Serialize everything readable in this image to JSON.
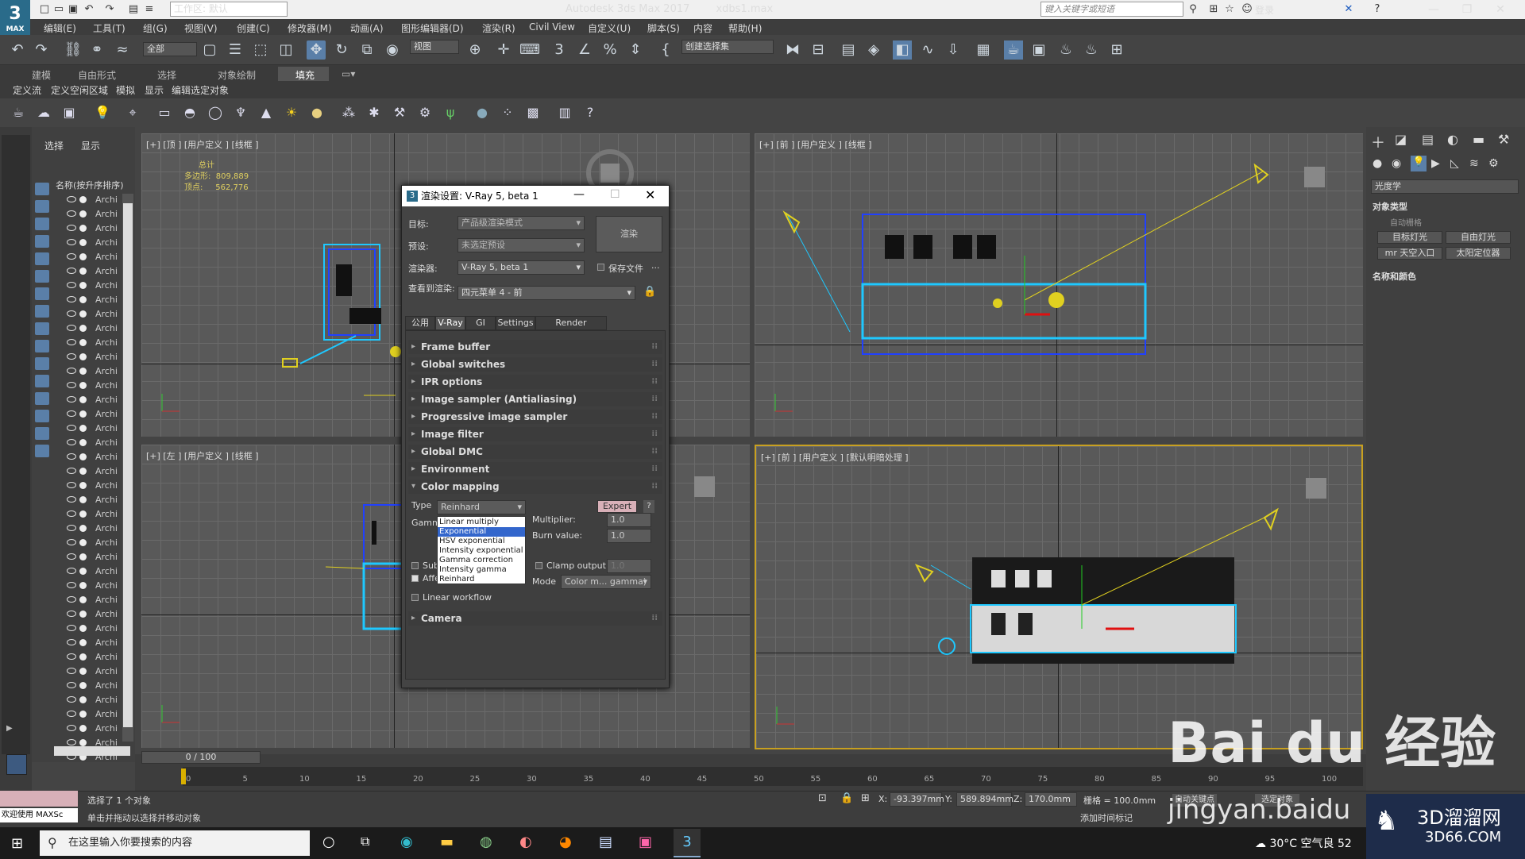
{
  "titlebar": {
    "workspace": "工作区: 默认",
    "title": "Autodesk 3ds Max 2017",
    "file": "xdbs1.max",
    "search_placeholder": "键入关键字或短语",
    "login": "登录",
    "logo_text": "3",
    "logo_sub": "MAX"
  },
  "menus": [
    "编辑(E)",
    "工具(T)",
    "组(G)",
    "视图(V)",
    "创建(C)",
    "修改器(M)",
    "动画(A)",
    "图形编辑器(D)",
    "渲染(R)",
    "Civil View",
    "自定义(U)",
    "脚本(S)",
    "内容",
    "帮助(H)"
  ],
  "toolbar": {
    "filter": "全部",
    "view": "视图",
    "selection_set": "创建选择集"
  },
  "ribbon": {
    "tabs": [
      "建模",
      "自由形式",
      "选择",
      "对象绘制",
      "填充"
    ],
    "active_tab": "填充",
    "subtabs": [
      "定义流",
      "定义空闲区域",
      "模拟",
      "显示",
      "编辑选定对象"
    ]
  },
  "scene_explorer": {
    "tabs": [
      "选择",
      "显示"
    ],
    "header": "名称(按升序排序)",
    "rows": [
      "Archi",
      "Archi",
      "Archi",
      "Archi",
      "Archi",
      "Archi",
      "Archi",
      "Archi",
      "Archi",
      "Archi",
      "Archi",
      "Archi",
      "Archi",
      "Archi",
      "Archi",
      "Archi",
      "Archi",
      "Archi",
      "Archi",
      "Archi",
      "Archi",
      "Archi",
      "Archi",
      "Archi",
      "Archi",
      "Archi",
      "Archi",
      "Archi",
      "Archi",
      "Archi",
      "Archi",
      "Archi",
      "Archi",
      "Archi",
      "Archi",
      "Archi",
      "Archi",
      "Archi",
      "Archi",
      "Archi"
    ]
  },
  "viewports": {
    "top": {
      "label": "[+] [顶 ] [用户定义 ] [线框 ]",
      "stats_title": "总计",
      "poly_label": "多边形:",
      "poly": "809,889",
      "vert_label": "顶点:",
      "vert": "562,776"
    },
    "front": {
      "label": "[+] [前 ] [用户定义 ] [线框 ]"
    },
    "left": {
      "label": "[+] [左 ] [用户定义 ] [线框 ]"
    },
    "persp": {
      "label": "[+] [前 ] [用户定义 ] [默认明暗处理 ]"
    }
  },
  "command_panel": {
    "dropdown": "光度学",
    "section1": "对象类型",
    "auto_grid": "自动栅格",
    "buttons": [
      "目标灯光",
      "自由灯光",
      "mr 天空入口",
      "太阳定位器"
    ],
    "section2": "名称和颜色"
  },
  "render_dialog": {
    "title": "渲染设置: V-Ray 5, beta 1",
    "target_label": "目标:",
    "target": "产品级渲染模式",
    "preset_label": "预设:",
    "preset": "未选定预设",
    "renderer_label": "渲染器:",
    "renderer": "V-Ray 5, beta 1",
    "save_file": "保存文件",
    "view_label": "查看到渲染:",
    "view": "四元菜单 4 - 前",
    "render_button": "渲染",
    "tabs": [
      "公用",
      "V-Ray",
      "GI",
      "Settings",
      "Render Elements"
    ],
    "active_tab": "V-Ray",
    "rollouts_top": [
      "Frame buffer",
      "Global switches",
      "IPR options",
      "Image sampler (Antialiasing)",
      "Progressive image sampler",
      "Image filter",
      "Global DMC",
      "Environment"
    ],
    "color_mapping": {
      "title": "Color mapping",
      "type_label": "Type",
      "type": "Reinhard",
      "expert": "Expert",
      "gamma_label": "Gamma",
      "multiplier_label": "Multiplier:",
      "multiplier": "1.0",
      "burn_label": "Burn value:",
      "burn": "1.0",
      "clamp_label": "Clamp output",
      "clamp_value": "1.0",
      "mode_label": "Mode",
      "mode": "Color m... gamma)",
      "sub_label": "Sub",
      "affect_label": "Affe",
      "linear_workflow": "Linear workflow",
      "options": [
        "Linear multiply",
        "Exponential",
        "HSV exponential",
        "Intensity exponential",
        "Gamma correction",
        "Intensity gamma",
        "Reinhard"
      ],
      "selected_option": "Exponential"
    },
    "rollout_camera": "Camera"
  },
  "timeline": {
    "frame": "0 / 100",
    "ticks": [
      "0",
      "5",
      "10",
      "15",
      "20",
      "25",
      "30",
      "35",
      "40",
      "45",
      "50",
      "55",
      "60",
      "65",
      "70",
      "75",
      "80",
      "85",
      "90",
      "95",
      "100"
    ]
  },
  "status": {
    "selected": "选择了 1 个对象",
    "hint": "单击并拖动以选择并移动对象",
    "welcome": "欢迎使用 MAXSc",
    "x_label": "X:",
    "x": "-93.397mm",
    "y_label": "Y:",
    "y": "589.894mm",
    "z_label": "Z:",
    "z": "170.0mm",
    "grid": "栅格 = 100.0mm",
    "time_tag": "添加时间标记",
    "auto_key": "自动关键点",
    "set_key": "选定对象"
  },
  "taskbar": {
    "search": "在这里输入你要搜索的内容",
    "weather": "30°C 空气良 52"
  },
  "watermarks": {
    "baidu": "Bai du 经验",
    "jingyan": "jingyan.baidu",
    "site_cn": "3D溜溜网",
    "site_en": "3D66.COM"
  },
  "colors": {
    "accent": "#1e90ff",
    "viewport_bg": "#595959",
    "active_border": "#c8a020"
  }
}
